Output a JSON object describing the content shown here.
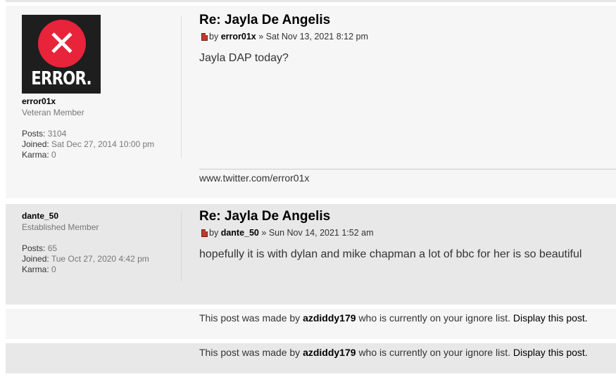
{
  "posts": [
    {
      "title": "Re: Jayla De Angelis",
      "by_prefix": "by",
      "author": "error01x",
      "date_sep": "»",
      "date": "Sat Nov 13, 2021 8:12 pm",
      "content": "Jayla DAP today?",
      "signature": "www.twitter.com/error01x",
      "profile": {
        "avatar_text": "ERROR.",
        "avatar_icon": "x-circle-icon",
        "username": "error01x",
        "rank": "Veteran Member",
        "posts_label": "Posts:",
        "posts_value": "3104",
        "joined_label": "Joined:",
        "joined_value": "Sat Dec 27, 2014 10:00 pm",
        "karma_label": "Karma:",
        "karma_value": "0"
      }
    },
    {
      "title": "Re: Jayla De Angelis",
      "by_prefix": "by",
      "author": "dante_50",
      "date_sep": "»",
      "date": "Sun Nov 14, 2021 1:52 am",
      "content": "hopefully it is with dylan and mike chapman a lot of bbc for her is so beautiful",
      "profile": {
        "username": "dante_50",
        "rank": "Established Member",
        "posts_label": "Posts:",
        "posts_value": "65",
        "joined_label": "Joined:",
        "joined_value": "Tue Oct 27, 2020 4:42 pm",
        "karma_label": "Karma:",
        "karma_value": "0"
      }
    }
  ],
  "ignored": [
    {
      "prefix": "This post was made by",
      "user": "azdiddy179",
      "suffix": "who is currently on your ignore list.",
      "link": "Display this post."
    },
    {
      "prefix": "This post was made by",
      "user": "azdiddy179",
      "suffix": "who is currently on your ignore list.",
      "link": "Display this post."
    }
  ],
  "colors": {
    "bg1": "#f6f6f6",
    "bg2": "#e8e8e8",
    "avatar_bg": "#1e1e1e",
    "avatar_circle": "#e8243a"
  }
}
